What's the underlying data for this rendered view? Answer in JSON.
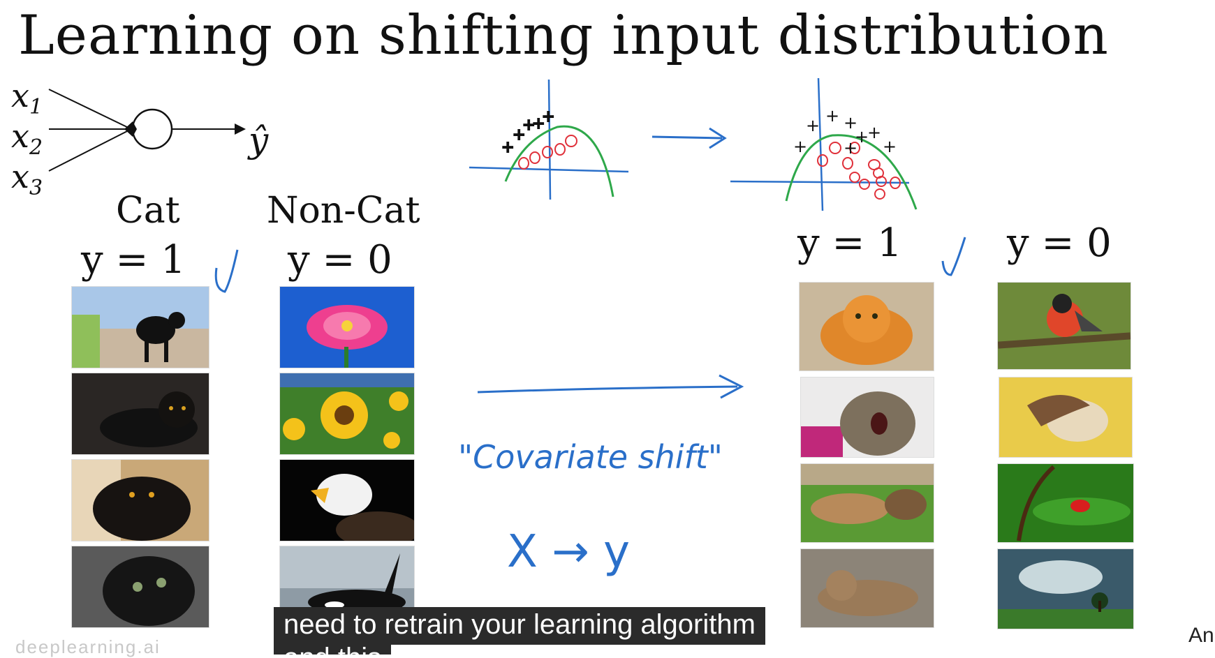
{
  "title": "Learning on shifting input distribution",
  "network": {
    "inputs": [
      "x1",
      "x2",
      "x3"
    ],
    "output": "ŷ"
  },
  "left": {
    "cat_label": "Cat",
    "noncat_label": "Non-Cat",
    "cat_y": "y = 1",
    "noncat_y": "y = 0"
  },
  "right": {
    "cat_y": "y = 1",
    "noncat_y": "y = 0"
  },
  "annotations": {
    "covariate": "\"Covariate shift\"",
    "x_to_y": "X → y"
  },
  "subtitle": {
    "line1": "need to retrain your learning algorithm",
    "line2": "and this"
  },
  "watermark": "deeplearning.ai",
  "corner_text": "An",
  "colors": {
    "ink": "#2a6fc9",
    "boundary": "#2ea84a",
    "circles": "#e0303a"
  }
}
